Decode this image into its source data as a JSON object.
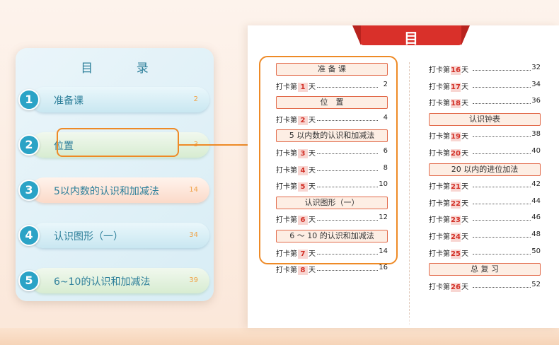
{
  "left": {
    "title": "目 录",
    "items": [
      {
        "num": "1",
        "label": "准备课",
        "page": "2",
        "style": "blue"
      },
      {
        "num": "2",
        "label": "位置",
        "page": "3",
        "style": "green"
      },
      {
        "num": "3",
        "label": "5以内数的认识和加减法",
        "page": "14",
        "style": "orange"
      },
      {
        "num": "4",
        "label": "认识图形（一）",
        "page": "34",
        "style": "blue"
      },
      {
        "num": "5",
        "label": "6~10的认识和加减法",
        "page": "39",
        "style": "green"
      }
    ]
  },
  "right": {
    "title": "目 录",
    "prefix": "打卡第",
    "suffix": "天",
    "col1": [
      {
        "type": "section",
        "label": "准 备 课"
      },
      {
        "type": "entry",
        "day": "1",
        "page": "2"
      },
      {
        "type": "section",
        "label": "位　置"
      },
      {
        "type": "entry",
        "day": "2",
        "page": "4"
      },
      {
        "type": "section",
        "label": "5 以内数的认识和加减法"
      },
      {
        "type": "entry",
        "day": "3",
        "page": "6"
      },
      {
        "type": "entry",
        "day": "4",
        "page": "8"
      },
      {
        "type": "entry",
        "day": "5",
        "page": "10"
      },
      {
        "type": "section",
        "label": "认识图形（一）"
      },
      {
        "type": "entry",
        "day": "6",
        "page": "12"
      },
      {
        "type": "section",
        "label": "6 ～ 10 的认识和加减法"
      },
      {
        "type": "entry",
        "day": "7",
        "page": "14"
      },
      {
        "type": "entry",
        "day": "8",
        "page": "16"
      }
    ],
    "col2": [
      {
        "type": "entry",
        "day": "16",
        "page": "32"
      },
      {
        "type": "entry",
        "day": "17",
        "page": "34"
      },
      {
        "type": "entry",
        "day": "18",
        "page": "36"
      },
      {
        "type": "section",
        "label": "认识钟表"
      },
      {
        "type": "entry",
        "day": "19",
        "page": "38"
      },
      {
        "type": "entry",
        "day": "20",
        "page": "40"
      },
      {
        "type": "section",
        "label": "20 以内的进位加法"
      },
      {
        "type": "entry",
        "day": "21",
        "page": "42"
      },
      {
        "type": "entry",
        "day": "22",
        "page": "44"
      },
      {
        "type": "entry",
        "day": "23",
        "page": "46"
      },
      {
        "type": "entry",
        "day": "24",
        "page": "48"
      },
      {
        "type": "entry",
        "day": "25",
        "page": "50"
      },
      {
        "type": "section",
        "label": "总 复 习"
      },
      {
        "type": "entry",
        "day": "26",
        "page": "52"
      }
    ]
  }
}
